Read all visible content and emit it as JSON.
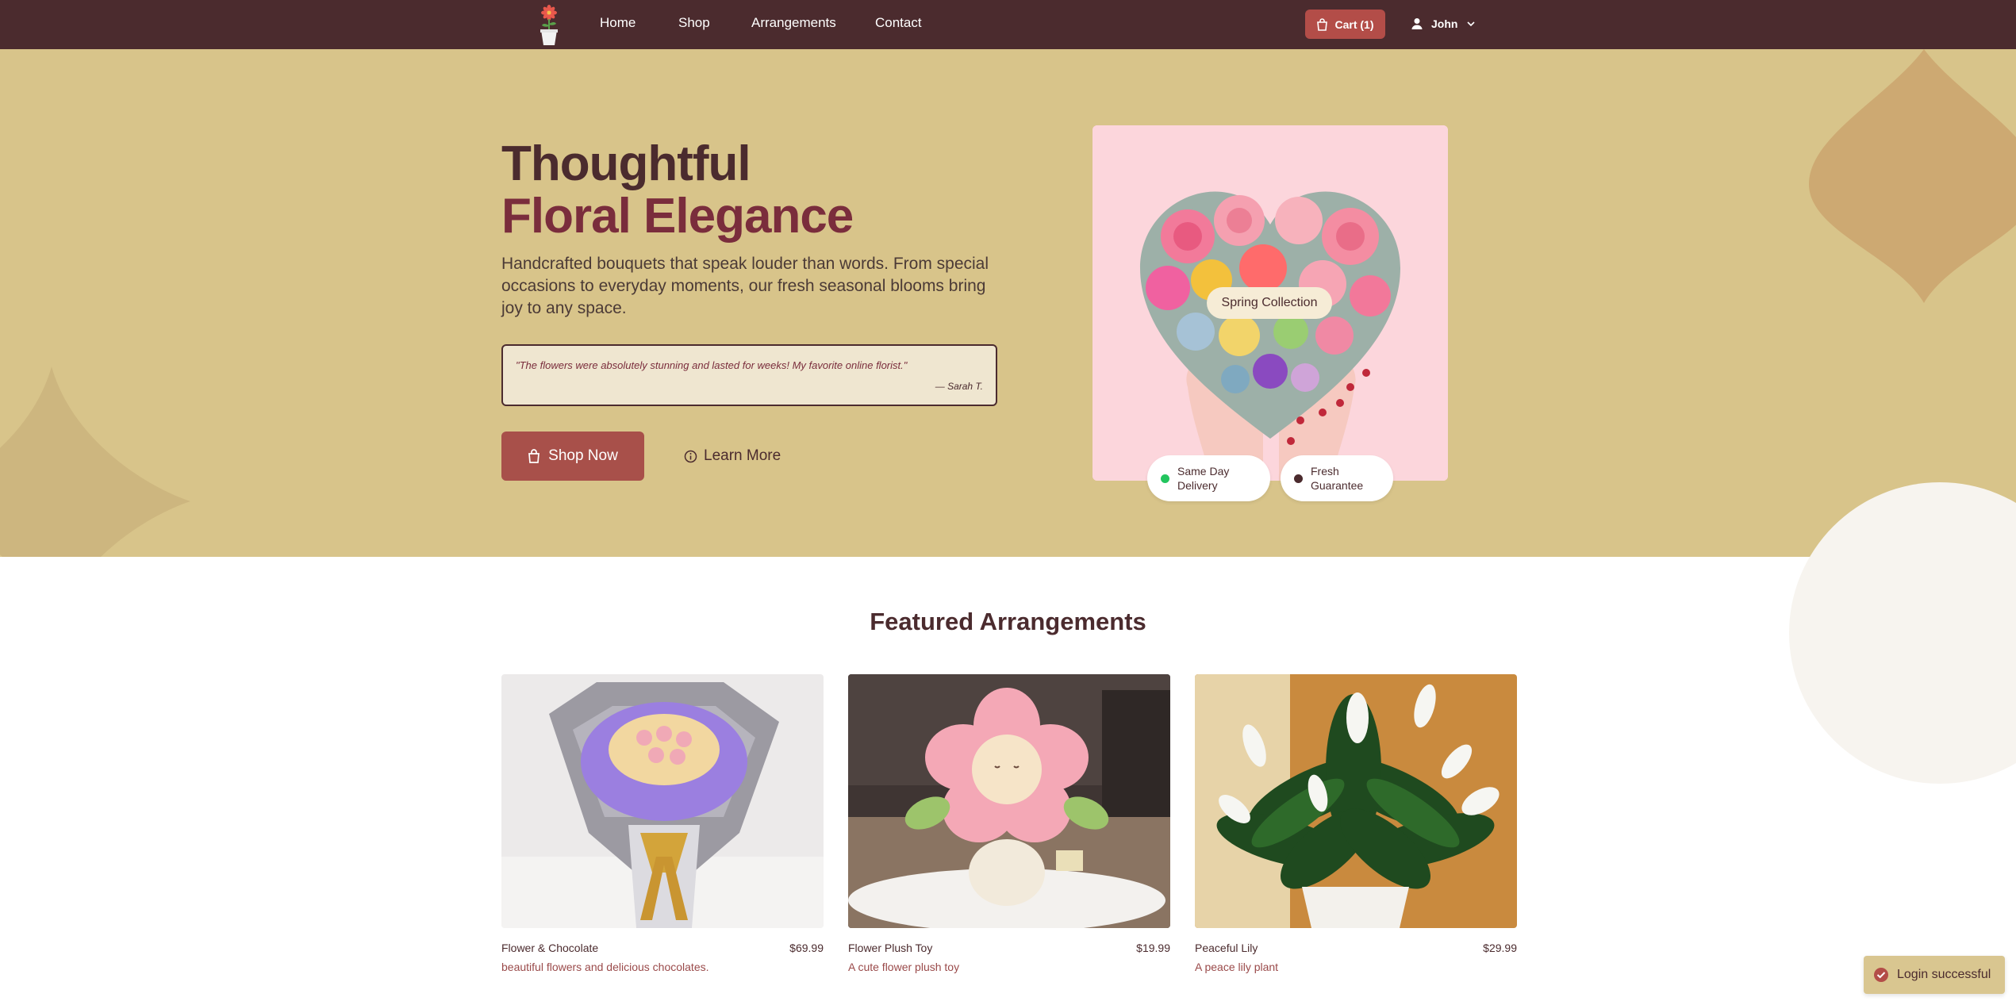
{
  "nav": {
    "links": [
      "Home",
      "Shop",
      "Arrangements",
      "Contact"
    ],
    "cart_label": "Cart (1)",
    "user_name": "John"
  },
  "hero": {
    "title_line1": "Thoughtful",
    "title_line2": "Floral Elegance",
    "description": "Handcrafted bouquets that speak louder than words. From special occasions to everyday moments, our fresh seasonal blooms bring joy to any space.",
    "testimonial_quote": "\"The flowers were absolutely stunning and lasted for weeks! My favorite online florist.\"",
    "testimonial_author": "— Sarah T.",
    "shop_button": "Shop Now",
    "learn_button": "Learn More",
    "image_badge": "Spring Collection",
    "features": [
      {
        "line1": "Same Day",
        "line2": "Delivery",
        "dot_color": "#22c55e"
      },
      {
        "line1": "Fresh",
        "line2": "Guarantee",
        "dot_color": "#4b2b2e"
      }
    ]
  },
  "featured": {
    "title": "Featured Arrangements",
    "products": [
      {
        "name": "Flower & Chocolate",
        "price": "$69.99",
        "description": "beautiful flowers and delicious chocolates."
      },
      {
        "name": "Flower Plush Toy",
        "price": "$19.99",
        "description": "A cute flower plush toy"
      },
      {
        "name": "Peaceful Lily",
        "price": "$29.99",
        "description": "A peace lily plant"
      }
    ]
  },
  "toast": {
    "message": "Login successful"
  },
  "colors": {
    "nav_bg": "#4b2b2e",
    "hero_bg": "#d8c48a",
    "accent": "#b34d48",
    "title_secondary": "#7a2d3c"
  }
}
